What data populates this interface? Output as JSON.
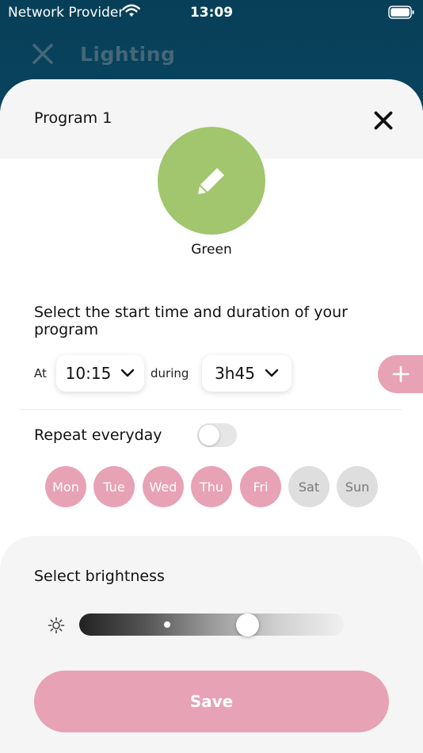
{
  "status_bar": {
    "carrier": "Network Provider",
    "time": "13:09",
    "wifi_icon": "wifi-icon",
    "battery_icon": "battery-icon"
  },
  "background": {
    "title": "Lighting",
    "close_icon": "close-icon"
  },
  "sheet": {
    "title": "Program 1",
    "close_icon": "close-icon"
  },
  "color": {
    "name": "Green",
    "hex": "#a1c66e",
    "edit_icon": "pencil-icon"
  },
  "schedule": {
    "instruction": "Select the start time and duration of your program",
    "at_label": "At",
    "start_time": "10:15",
    "during_label": "during",
    "duration": "3h45",
    "add_label": "+"
  },
  "repeat": {
    "label": "Repeat everyday",
    "enabled": false
  },
  "days": [
    {
      "label": "Mon",
      "selected": true
    },
    {
      "label": "Tue",
      "selected": true
    },
    {
      "label": "Wed",
      "selected": true
    },
    {
      "label": "Thu",
      "selected": true
    },
    {
      "label": "Fri",
      "selected": true
    },
    {
      "label": "Sat",
      "selected": false
    },
    {
      "label": "Sun",
      "selected": false
    }
  ],
  "brightness": {
    "label": "Select brightness",
    "icon": "sun-icon",
    "value_fraction": 0.65
  },
  "save_label": "Save",
  "colors": {
    "accent_pink": "#e8a2b5",
    "selected_green": "#a1c66e",
    "day_off": "#dedede",
    "header_bg": "#083f58"
  }
}
